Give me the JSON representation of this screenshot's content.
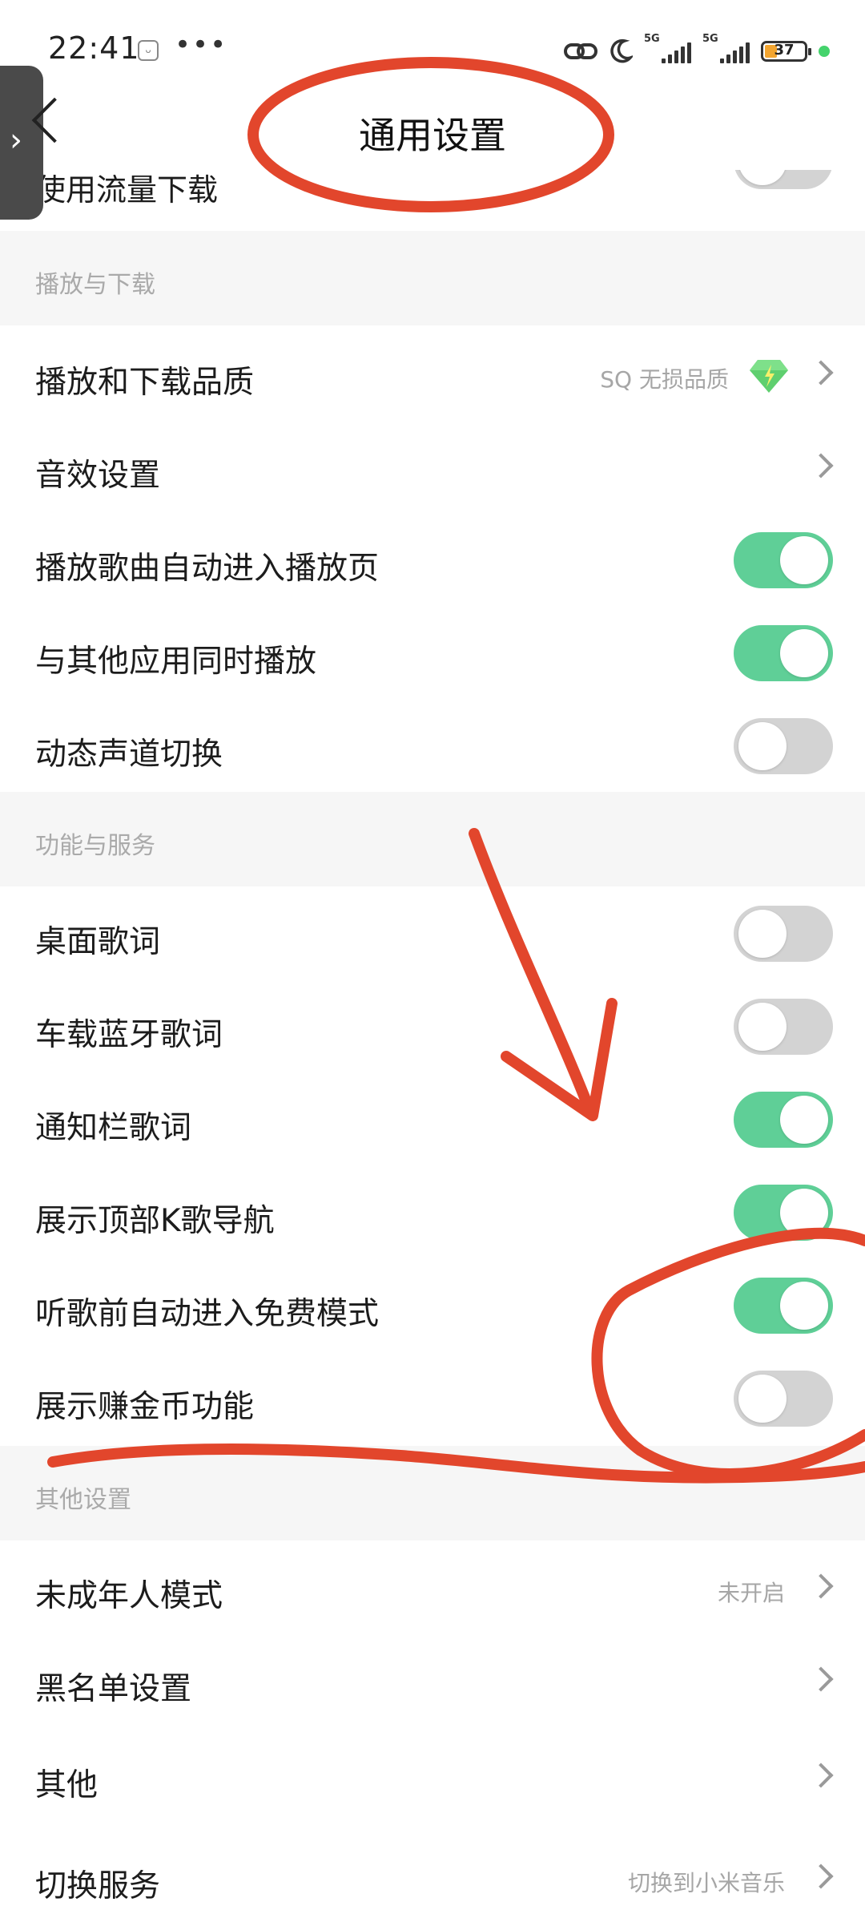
{
  "status_bar": {
    "time": "22:41",
    "dots": "•••",
    "battery": "37",
    "sig1": "5G",
    "sig2": "5G"
  },
  "header": {
    "title": "通用设置",
    "partial_row_label": "使用流量下载"
  },
  "sections": {
    "play": {
      "title": "播放与下载",
      "quality_label": "播放和下载品质",
      "quality_value": "SQ 无损品质",
      "sound_label": "音效设置",
      "auto_enter_label": "播放歌曲自动进入播放页",
      "concurrent_label": "与其他应用同时播放",
      "dynamic_channel_label": "动态声道切换"
    },
    "features": {
      "title": "功能与服务",
      "desktop_lyrics_label": "桌面歌词",
      "car_bt_lyrics_label": "车载蓝牙歌词",
      "notif_lyrics_label": "通知栏歌词",
      "k_song_nav_label": "展示顶部K歌导航",
      "free_mode_label": "听歌前自动进入免费模式",
      "coins_label": "展示赚金币功能"
    },
    "other": {
      "title": "其他设置",
      "minor_mode_label": "未成年人模式",
      "minor_mode_value": "未开启",
      "blacklist_label": "黑名单设置",
      "misc_label": "其他",
      "switch_service_label": "切换服务",
      "switch_service_value": "切换到小米音乐"
    }
  },
  "toggles": {
    "use_data_download": false,
    "auto_enter_play_page": true,
    "concurrent_play": true,
    "dynamic_channel": false,
    "desktop_lyrics": false,
    "car_bt_lyrics": false,
    "notif_lyrics": true,
    "k_song_nav": true,
    "free_mode": true,
    "coins": false
  },
  "colors": {
    "toggle_on": "#5fcf97",
    "toggle_off": "#d3d3d3",
    "annotation": "#e2462c",
    "section_bg": "#f6f6f6"
  }
}
